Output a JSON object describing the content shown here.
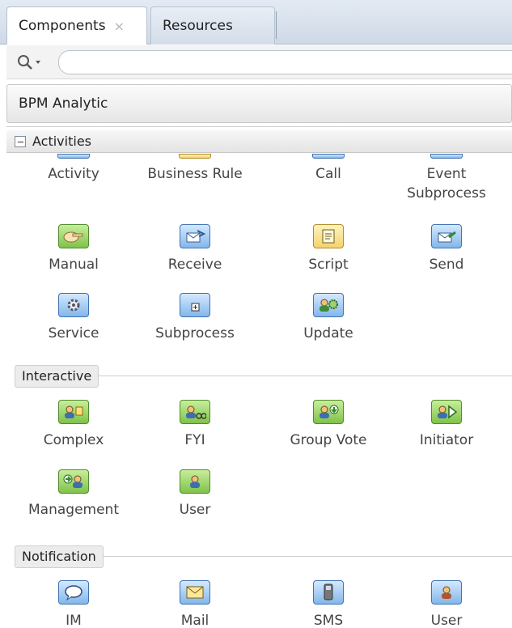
{
  "tabs": [
    {
      "label": "Components",
      "close": "×"
    },
    {
      "label": "Resources"
    }
  ],
  "search": {
    "value": "",
    "placeholder": ""
  },
  "dropdown": {
    "selected": "BPM Analytic"
  },
  "section": {
    "label": "Activities"
  },
  "activities_row1": [
    "Activity",
    "Business Rule",
    "Call",
    "Event Subprocess"
  ],
  "activities": [
    {
      "label": "Manual",
      "icon": "hand-icon"
    },
    {
      "label": "Receive",
      "icon": "receive-envelope-icon"
    },
    {
      "label": "Script",
      "icon": "script-icon"
    },
    {
      "label": "Send",
      "icon": "send-envelope-icon"
    },
    {
      "label": "Service",
      "icon": "gear-icon"
    },
    {
      "label": "Subprocess",
      "icon": "subprocess-icon"
    },
    {
      "label": "Update",
      "icon": "update-user-icon"
    }
  ],
  "interactive": {
    "label": "Interactive",
    "items": [
      {
        "label": "Complex",
        "icon": "complex-user-icon"
      },
      {
        "label": "FYI",
        "icon": "fyi-user-icon"
      },
      {
        "label": "Group Vote",
        "icon": "group-vote-icon"
      },
      {
        "label": "Initiator",
        "icon": "initiator-icon"
      },
      {
        "label": "Management",
        "icon": "management-icon"
      },
      {
        "label": "User",
        "icon": "user-icon"
      }
    ]
  },
  "notification": {
    "label": "Notification",
    "items": [
      {
        "label": "IM",
        "icon": "chat-bubble-icon"
      },
      {
        "label": "Mail",
        "icon": "mail-icon"
      },
      {
        "label": "SMS",
        "icon": "phone-icon"
      },
      {
        "label": "User",
        "icon": "notify-user-icon"
      }
    ]
  }
}
